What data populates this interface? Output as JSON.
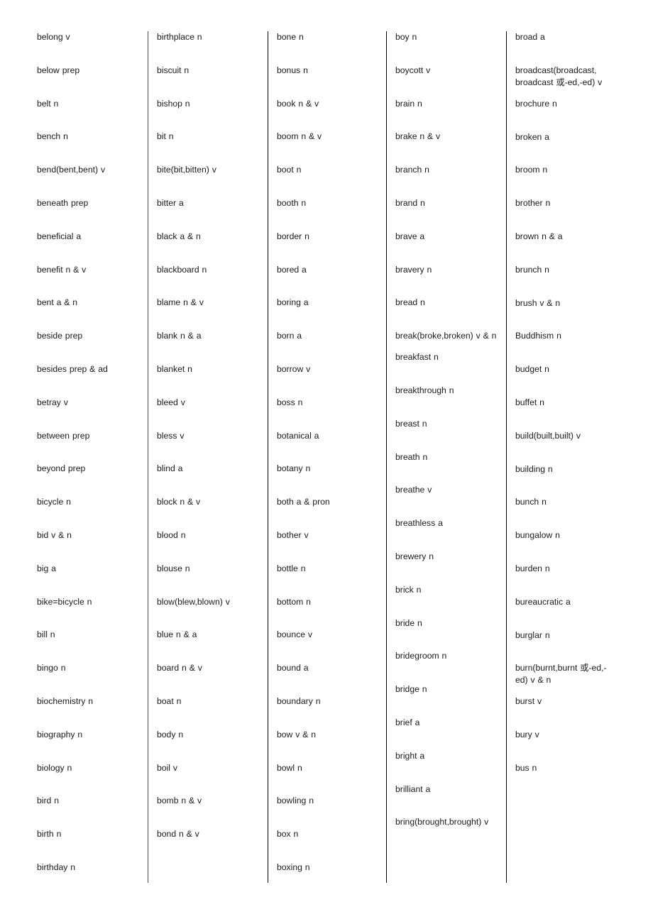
{
  "document": {
    "kind": "vocabulary-word-list",
    "letter_range": "be - bus",
    "column_count": 5
  },
  "columns": [
    {
      "id": "column-1",
      "words": [
        "belong v",
        "below prep",
        "belt n",
        "bench n",
        "bend(bent,bent) v",
        "beneath prep",
        "beneficial a",
        "benefit n & v",
        "bent a & n",
        "beside prep",
        "besides prep & ad",
        "betray v",
        "between prep",
        "beyond prep",
        "bicycle n",
        "bid v & n",
        "big a",
        "bike=bicycle n",
        "bill n",
        "bingo n",
        "biochemistry n",
        "biography n",
        "biology n",
        "bird n",
        "birth n",
        "birthday n"
      ]
    },
    {
      "id": "column-2",
      "words": [
        "birthplace n",
        "biscuit n",
        "bishop n",
        "bit n",
        "bite(bit,bitten) v",
        "bitter a",
        "black a & n",
        "blackboard n",
        "blame n & v",
        "blank n & a",
        "blanket n",
        "bleed v",
        "bless v",
        "blind a",
        "block n & v",
        "blood n",
        "blouse n",
        "blow(blew,blown) v",
        "blue n & a",
        "board n & v",
        "boat n",
        "body n",
        "boil v",
        "bomb n & v",
        "bond n & v"
      ]
    },
    {
      "id": "column-3",
      "words": [
        "bone n",
        "bonus n",
        "book n & v",
        "boom n & v",
        "boot n",
        "booth n",
        "border n",
        "bored a",
        "boring a",
        "born a",
        "borrow v",
        "boss n",
        "botanical a",
        "botany n",
        "both a & pron",
        "bother v",
        "bottle n",
        "bottom n",
        "bounce v",
        "bound a",
        "boundary n",
        "bow v & n",
        "bowl n",
        "bowling n",
        "box n",
        "boxing n"
      ]
    },
    {
      "id": "column-4",
      "words": [
        "boy n",
        "boycott v",
        "brain n",
        "brake n & v",
        "branch n",
        "brand n",
        "brave a",
        "bravery n",
        "bread n",
        "break(broke,broken) v & n",
        "breakfast n",
        "breakthrough n",
        "breast n",
        "breath n",
        "breathe v",
        "breathless a",
        "brewery n",
        "brick n",
        "bride n",
        "bridegroom n",
        "bridge n",
        "brief a",
        "bright a",
        "brilliant a",
        "bring(brought,brought) v"
      ]
    },
    {
      "id": "column-5",
      "words": [
        "broad a",
        "broadcast(broadcast, broadcast 或-ed,-ed) v",
        "brochure n",
        "broken a",
        "broom n",
        "brother n",
        "brown n & a",
        "brunch n",
        "brush v & n",
        "Buddhism n",
        "budget n",
        "buffet n",
        "build(built,built) v",
        "building n",
        "bunch n",
        "bungalow n",
        "burden n",
        "bureaucratic a",
        "burglar n",
        "burn(burnt,burnt 或-ed,-ed) v & n",
        "burst v",
        "bury v",
        "bus n"
      ]
    }
  ],
  "style": {
    "background": "#ffffff",
    "text_color": "#1a1a1a",
    "rule_color": "#000000"
  }
}
